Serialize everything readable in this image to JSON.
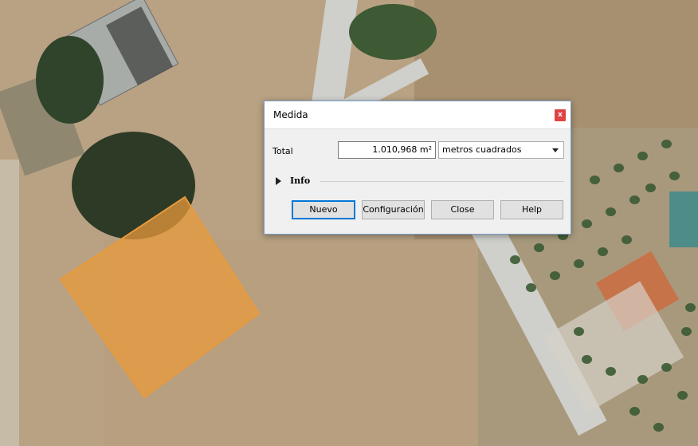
{
  "dialog": {
    "title": "Medida",
    "close_glyph": "x",
    "total_label": "Total",
    "total_value": "1.010,968 m²",
    "unit_selected": "metros cuadrados",
    "info_label": "Info",
    "buttons": {
      "nuevo": "Nuevo",
      "configuracion": "Configuración",
      "close": "Close",
      "help": "Help"
    }
  },
  "colors": {
    "measure_polygon": "#e89a3c",
    "dialog_border": "#7a9cc6",
    "default_button_border": "#0078d7",
    "close_button": "#e04343"
  }
}
